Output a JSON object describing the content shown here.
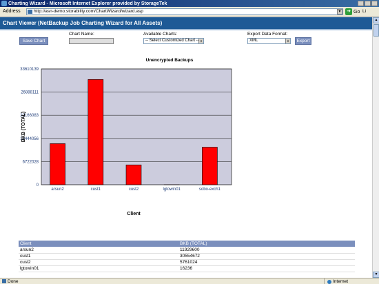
{
  "window": {
    "title": "Charting Wizard - Microsoft Internet Explorer provided by StorageTek"
  },
  "address_bar": {
    "label": "Address",
    "url": "http://asn-demo.storability.com/ChartWizard/wizard.asp",
    "go_label": "Go",
    "links_label": "Li"
  },
  "page": {
    "banner_title": "Chart Viewer (NetBackup Job Charting Wizard for All Assets)",
    "save_button": "Save Chart",
    "chart_name_label": "Chart Name:",
    "chart_name_value": "",
    "available_charts_label": "Available Charts:",
    "available_charts_selected": "-- Select Customized Chart --",
    "export_format_label": "Export Data Format:",
    "export_format_selected": "XML",
    "export_button": "Export"
  },
  "chart_data": {
    "type": "bar",
    "title": "Unencrypted Backups",
    "xlabel": "Client",
    "ylabel": "BKB (TOTAL)",
    "categories": [
      "arsun2",
      "cust1",
      "cust2",
      "lgtowin01",
      "sobo-exch1"
    ],
    "values": [
      11929600,
      30554672,
      5761024,
      16236,
      10900000
    ],
    "yticks": [
      0,
      6722028,
      13444056,
      20166083,
      26888111,
      33610139
    ],
    "ytick_labels": [
      "0",
      "6722028",
      "13444056",
      "20166083",
      "26888111",
      "33610139"
    ],
    "ylim": [
      0,
      33610139
    ],
    "bar_color": "#ff0000",
    "plot_bg": "#ccccdd",
    "grid": true
  },
  "table": {
    "headers": [
      "Client",
      "BKB (TOTAL)"
    ],
    "rows": [
      [
        "arsun2",
        "11929600"
      ],
      [
        "cust1",
        "30554672"
      ],
      [
        "cust2",
        "5761024"
      ],
      [
        "lgtowin01",
        "16236"
      ]
    ]
  },
  "status_bar": {
    "status": "Done",
    "zone": "Internet"
  }
}
